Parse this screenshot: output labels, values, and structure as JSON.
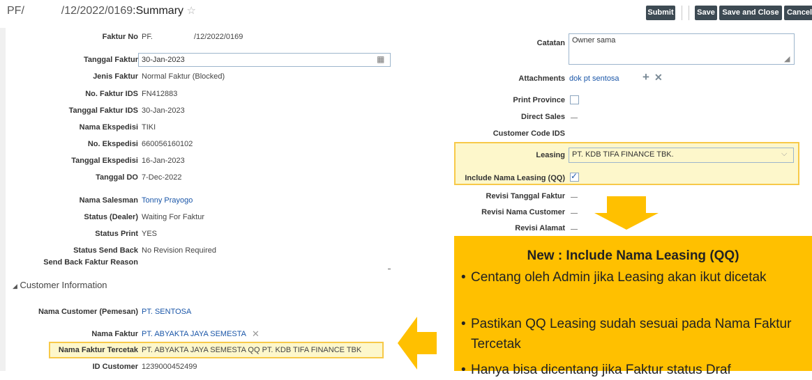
{
  "header": {
    "prefix": "PF/",
    "number": "/12/2022/0169",
    "separator": ":",
    "page": "Summary",
    "favorite_icon": "star-outline-icon"
  },
  "toolbar": {
    "submit": "Submit",
    "save": "Save",
    "save_close": "Save and Close",
    "cancel": "Cancel"
  },
  "faktur": {
    "faktur_no": {
      "label": "Faktur No",
      "prefix": "PF.",
      "value": "/12/2022/0169"
    },
    "tanggal_faktur": {
      "label": "Tanggal Faktur",
      "value": "30-Jan-2023"
    },
    "jenis_faktur": {
      "label": "Jenis Faktur",
      "value": "Normal Faktur (Blocked)"
    },
    "no_faktur_ids": {
      "label": "No. Faktur IDS",
      "value": "FN412883"
    },
    "tanggal_faktur_ids": {
      "label": "Tanggal Faktur IDS",
      "value": "30-Jan-2023"
    },
    "nama_ekspedisi": {
      "label": "Nama Ekspedisi",
      "value": "TIKI"
    },
    "no_ekspedisi": {
      "label": "No. Ekspedisi",
      "value": "660056160102"
    },
    "tanggal_ekspedisi": {
      "label": "Tanggal Ekspedisi",
      "value": "16-Jan-2023"
    },
    "tanggal_do": {
      "label": "Tanggal DO",
      "value": "7-Dec-2022"
    },
    "nama_salesman": {
      "label": "Nama Salesman",
      "value": "Tonny Prayogo"
    },
    "status_dealer": {
      "label": "Status (Dealer)",
      "value": "Waiting For Faktur"
    },
    "status_print": {
      "label": "Status Print",
      "value": "YES"
    },
    "status_send_back": {
      "label": "Status Send Back",
      "value": "No Revision Required"
    },
    "send_back_reason": {
      "label": "Send Back Faktur Reason"
    }
  },
  "customer": {
    "section_title": "Customer Information",
    "nama_customer": {
      "label": "Nama Customer (Pemesan)",
      "value": "PT. SENTOSA"
    },
    "nama_faktur": {
      "label": "Nama Faktur",
      "value": "PT. ABYAKTA JAYA SEMESTA"
    },
    "nama_faktur_tercetak": {
      "label": "Nama Faktur Tercetak",
      "value": "PT. ABYAKTA JAYA SEMESTA QQ PT. KDB TIFA FINANCE TBK"
    },
    "id_customer": {
      "label": "ID Customer",
      "value": "1239000452499"
    }
  },
  "right": {
    "catatan": {
      "label": "Catatan",
      "value": "Owner sama"
    },
    "attachments": {
      "label": "Attachments",
      "value": "dok pt sentosa"
    },
    "print_province": {
      "label": "Print Province",
      "checked": false
    },
    "direct_sales": {
      "label": "Direct Sales"
    },
    "customer_code_ids": {
      "label": "Customer Code IDS"
    },
    "leasing": {
      "label": "Leasing",
      "value": "PT. KDB TIFA FINANCE TBK."
    },
    "include_nama_leasing": {
      "label": "Include Nama Leasing (QQ)",
      "checked": true
    },
    "revisi_tanggal_faktur": {
      "label": "Revisi Tanggal Faktur"
    },
    "revisi_nama_customer": {
      "label": "Revisi Nama Customer"
    },
    "revisi_alamat": {
      "label": "Revisi Alamat"
    }
  },
  "callout": {
    "heading": "New : Include Nama Leasing (QQ)",
    "bullet1": "Centang oleh Admin jika Leasing akan ikut dicetak",
    "bullet2": "Pastikan QQ Leasing sudah sesuai pada Nama Faktur Tercetak",
    "bullet3_partial": "Hanya bisa dicentang jika Faktur status Draf",
    "color": "#ffc000"
  },
  "colors": {
    "highlight_border": "#f7c948",
    "highlight_fill": "#fdf7cb",
    "link": "#1a56a8",
    "button": "#3d4a53"
  }
}
